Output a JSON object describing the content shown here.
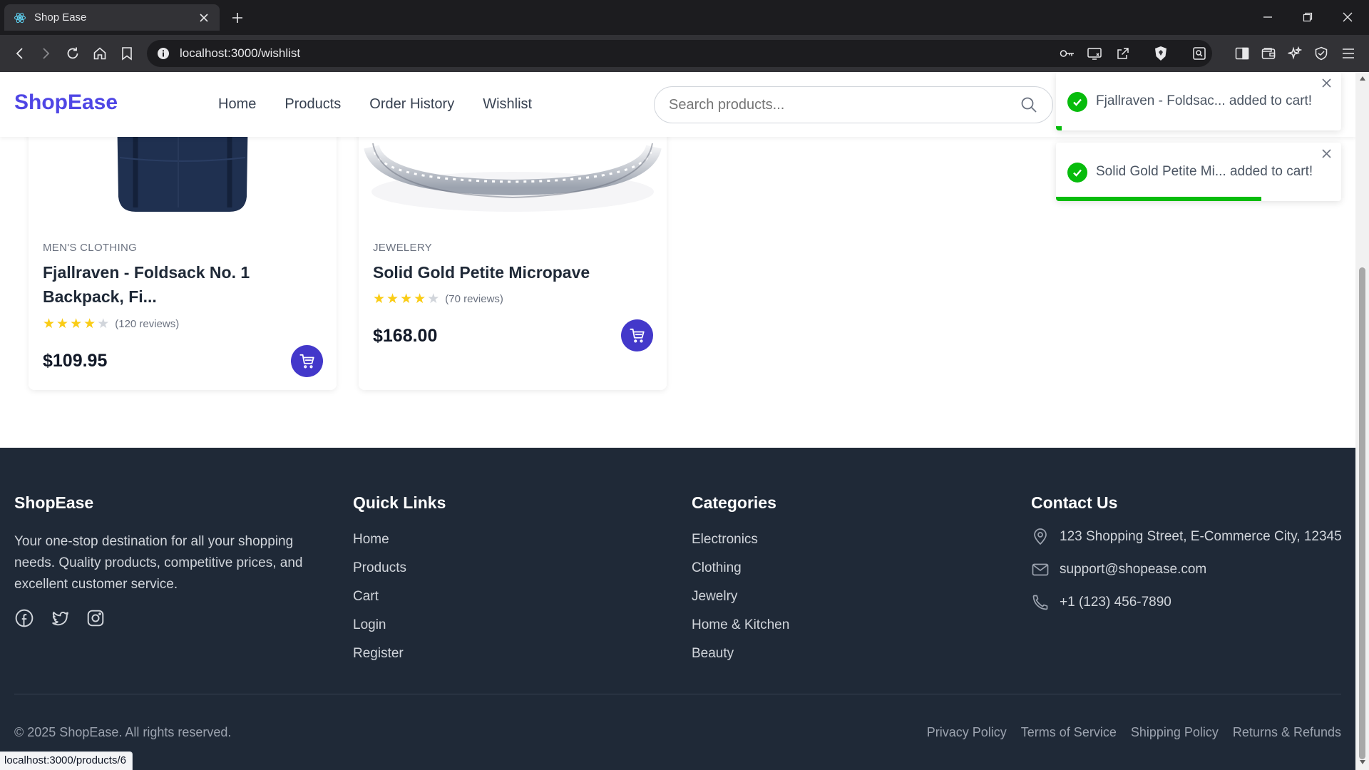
{
  "browser": {
    "tab_title": "Shop Ease",
    "url": "localhost:3000/wishlist",
    "status_url": "localhost:3000/products/6"
  },
  "header": {
    "logo": "ShopEase",
    "nav": [
      "Home",
      "Products",
      "Order History",
      "Wishlist"
    ],
    "search_placeholder": "Search products..."
  },
  "products": [
    {
      "category": "MEN'S CLOTHING",
      "name": "Fjallraven - Foldsack No. 1 Backpack, Fi...",
      "rating": 4,
      "reviews": "(120 reviews)",
      "price": "$109.95"
    },
    {
      "category": "JEWELERY",
      "name": "Solid Gold Petite Micropave",
      "rating": 4,
      "reviews": "(70 reviews)",
      "price": "$168.00"
    }
  ],
  "toasts": [
    {
      "message": "Fjallraven - Foldsac... added to cart!",
      "progress": 0.02
    },
    {
      "message": "Solid Gold Petite Mi... added to cart!",
      "progress": 0.72
    }
  ],
  "footer": {
    "brand": {
      "title": "ShopEase",
      "description": "Your one-stop destination for all your shopping needs. Quality products, competitive prices, and excellent customer service."
    },
    "quick_links": {
      "title": "Quick Links",
      "items": [
        "Home",
        "Products",
        "Cart",
        "Login",
        "Register"
      ]
    },
    "categories": {
      "title": "Categories",
      "items": [
        "Electronics",
        "Clothing",
        "Jewelry",
        "Home & Kitchen",
        "Beauty"
      ]
    },
    "contact": {
      "title": "Contact Us",
      "address": "123 Shopping Street, E-Commerce City, 12345",
      "email": "support@shopease.com",
      "phone": "+1 (123) 456-7890"
    },
    "copyright": "© 2025 ShopEase. All rights reserved.",
    "legal": [
      "Privacy Policy",
      "Terms of Service",
      "Shipping Policy",
      "Returns & Refunds"
    ]
  },
  "colors": {
    "brand": "#4f46e5",
    "cart_button": "#4338ca",
    "toast_success": "#07bc0c",
    "footer_bg": "#1f2937",
    "star": "#facc15"
  }
}
